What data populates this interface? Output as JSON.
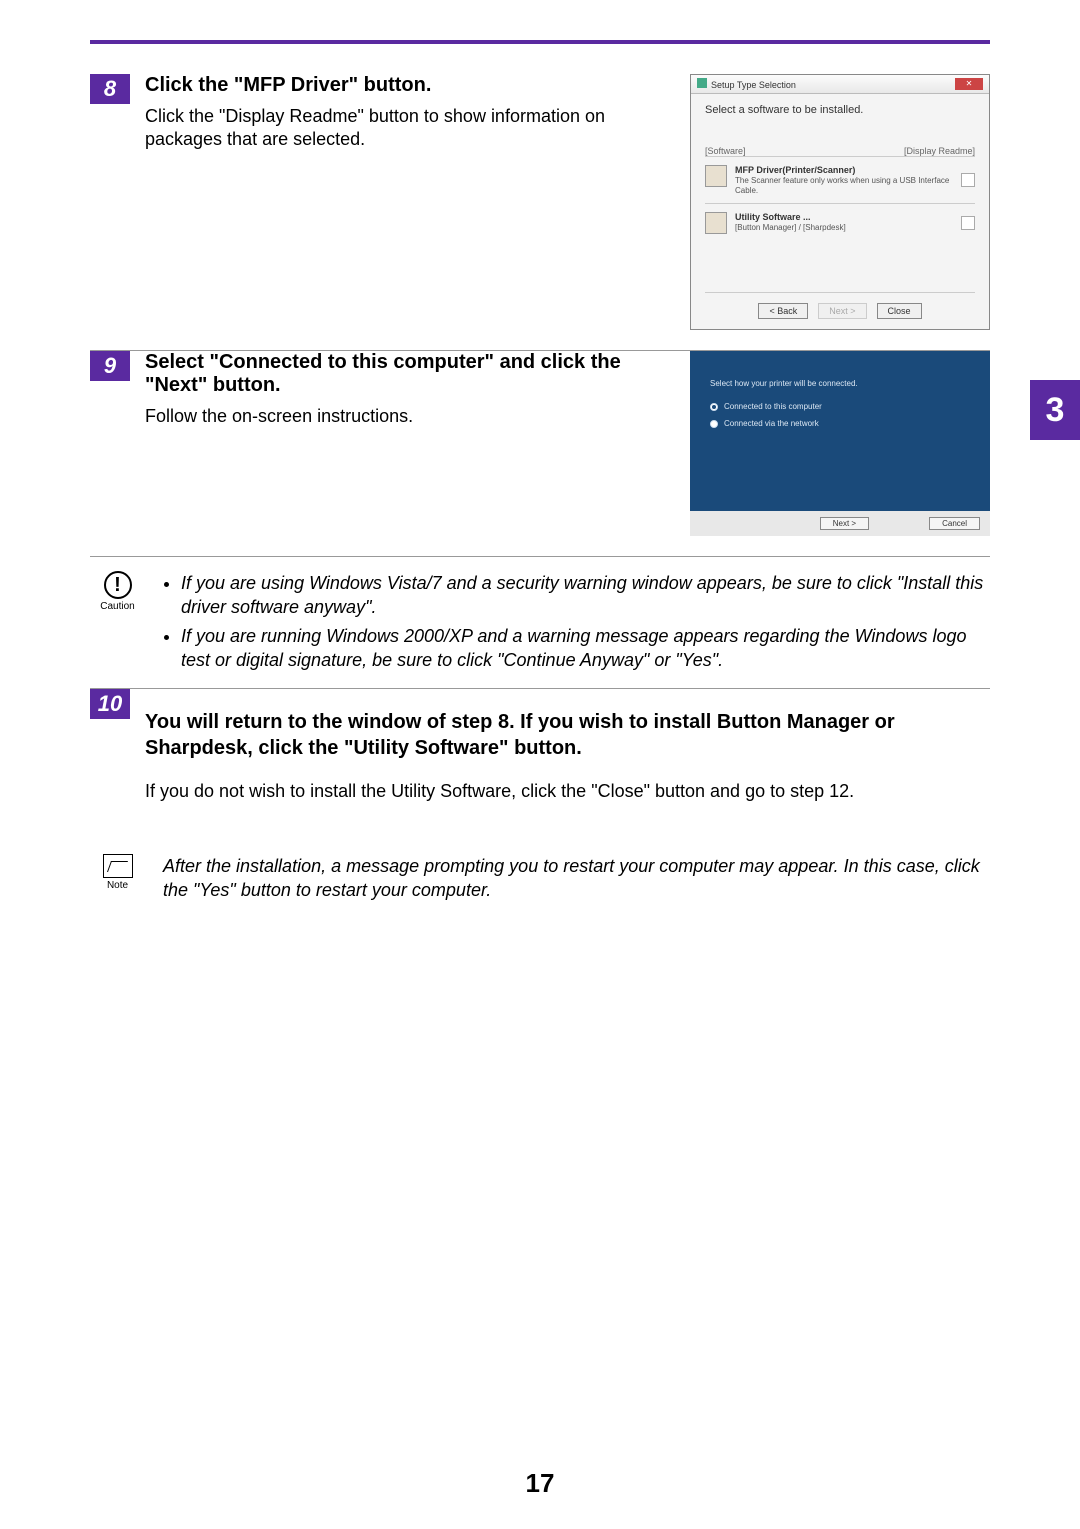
{
  "page_number": "17",
  "chapter_tab": "3",
  "steps": {
    "s8": {
      "num": "8",
      "title": "Click the \"MFP Driver\" button.",
      "body": "Click the \"Display Readme\" button to show information on packages that are selected."
    },
    "s9": {
      "num": "9",
      "title": "Select \"Connected to this computer\" and click the \"Next\" button.",
      "body": "Follow the on-screen instructions."
    },
    "s10": {
      "num": "10",
      "title": "You will return to the window of step 8. If you wish to install Button Manager or Sharpdesk, click the \"Utility Software\" button.",
      "body": "If you do not wish to install the Utility Software, click the \"Close\" button and go to step 12."
    }
  },
  "caution": {
    "label": "Caution",
    "items": [
      "If you are using Windows Vista/7 and a security warning window appears, be sure to click \"Install this driver software anyway\".",
      "If you are running Windows 2000/XP and a warning message appears regarding the Windows logo test or digital signature, be sure to click \"Continue Anyway\" or \"Yes\"."
    ]
  },
  "note": {
    "label": "Note",
    "text": "After the installation, a message prompting you to restart your computer may appear. In this case, click the \"Yes\" button to restart your computer."
  },
  "win1": {
    "title": "Setup Type Selection",
    "heading": "Select a software to be installed.",
    "left_label": "[Software]",
    "right_label": "[Display Readme]",
    "item1_title": "MFP Driver(Printer/Scanner)",
    "item1_desc": "The Scanner feature only works when using a USB Interface Cable.",
    "item2_title": "Utility Software ...",
    "item2_desc": "[Button Manager] / [Sharpdesk]",
    "back": "< Back",
    "next": "Next >",
    "close": "Close"
  },
  "win2": {
    "hint": "Select how your printer will be connected.",
    "opt1": "Connected to this computer",
    "opt2": "Connected via the network",
    "next": "Next >",
    "cancel": "Cancel"
  }
}
